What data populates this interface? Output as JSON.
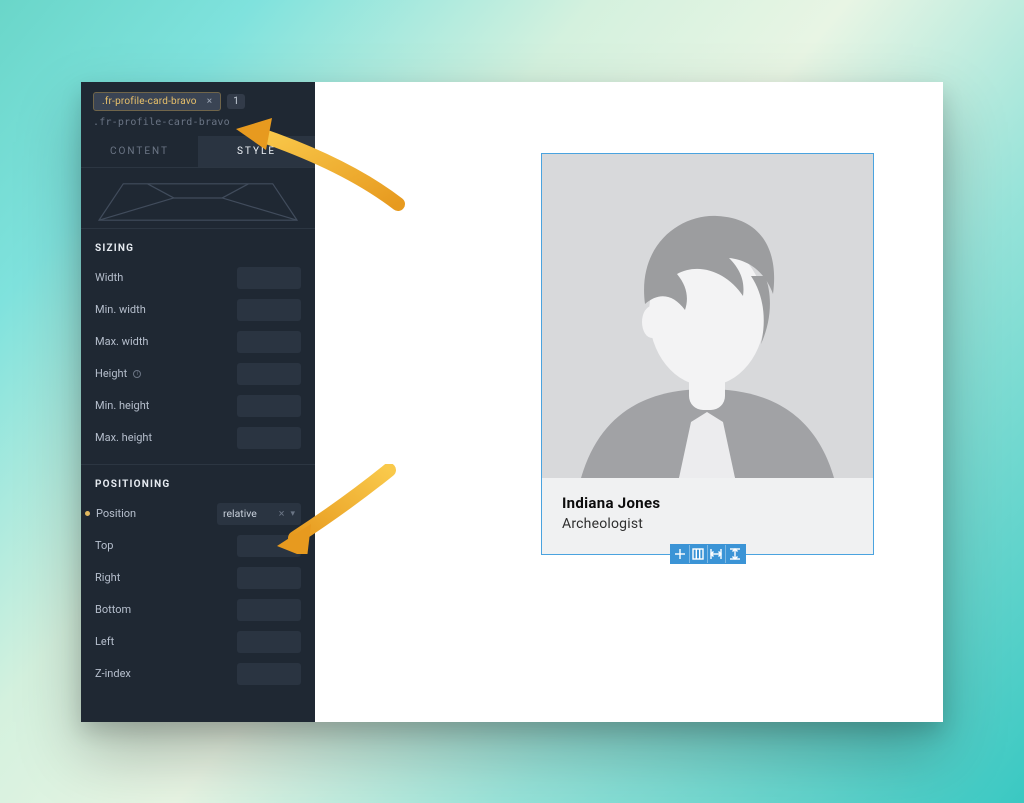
{
  "selector": {
    "chip": ".fr-profile-card-bravo",
    "count": "1",
    "breadcrumb": ".fr-profile-card-bravo"
  },
  "tabs": {
    "content": "CONTENT",
    "style": "STYLE"
  },
  "sections": {
    "sizing": {
      "title": "SIZING",
      "width": "Width",
      "min_width": "Min. width",
      "max_width": "Max. width",
      "height": "Height",
      "min_height": "Min. height",
      "max_height": "Max. height"
    },
    "positioning": {
      "title": "POSITIONING",
      "position_label": "Position",
      "position_value": "relative",
      "top": "Top",
      "right": "Right",
      "bottom": "Bottom",
      "left": "Left",
      "z_index": "Z-index"
    }
  },
  "card": {
    "name": "Indiana Jones",
    "role": "Archeologist"
  },
  "colors": {
    "panel_bg": "#1f2833",
    "accent": "#4aa3df",
    "gold": "#e8c06a",
    "arrow": "#f6b73c"
  }
}
